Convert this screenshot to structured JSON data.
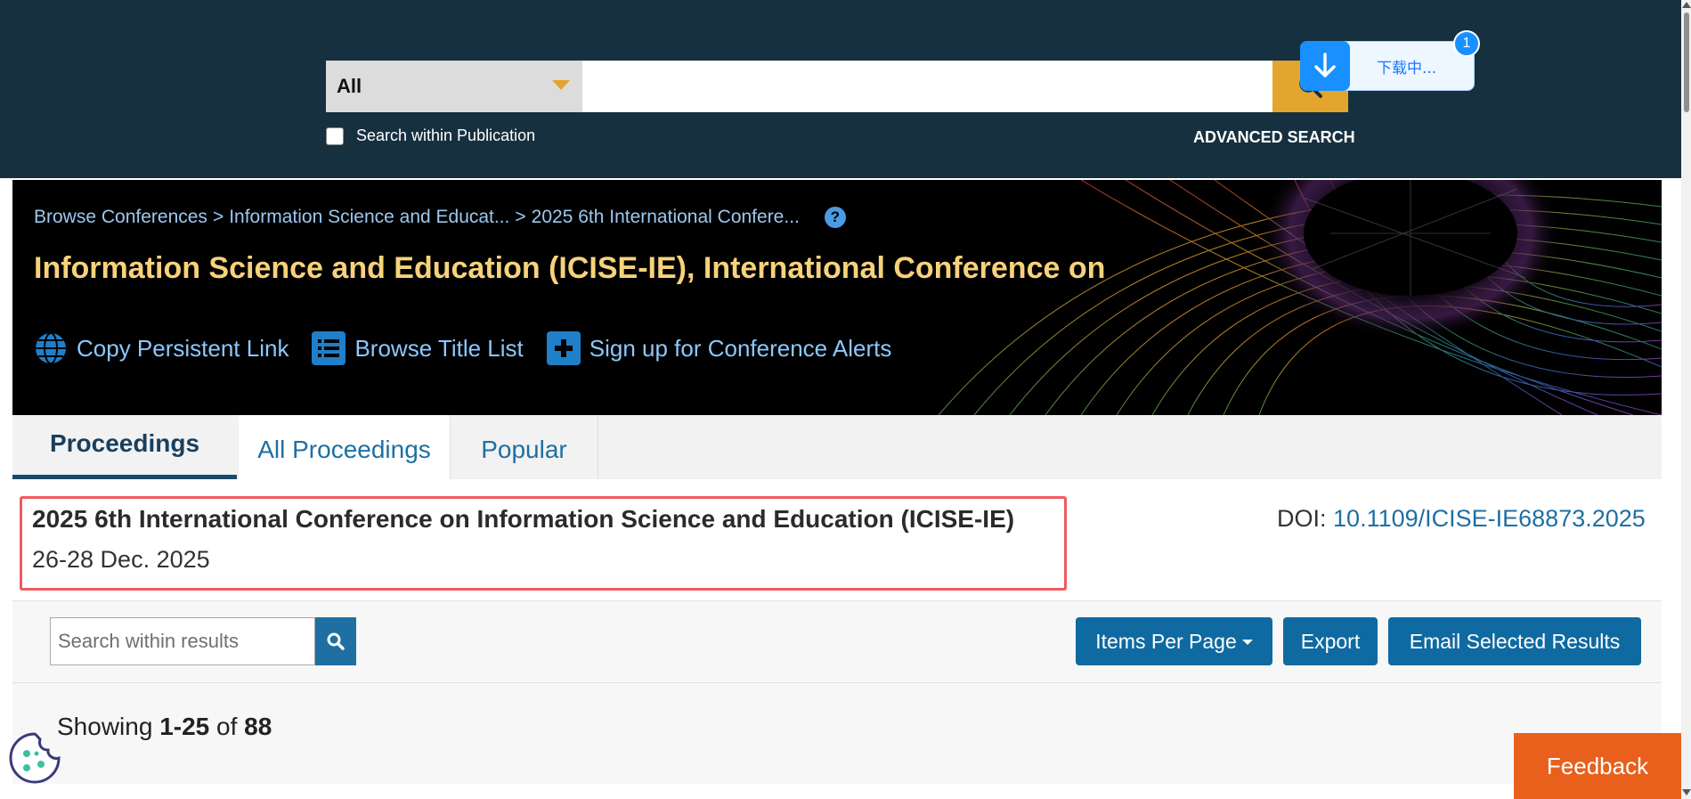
{
  "search": {
    "scope_value": "All",
    "query_value": "",
    "within_label": "Search within Publication",
    "advanced_label": "ADVANCED SEARCH"
  },
  "download": {
    "status": "下载中...",
    "count": "1"
  },
  "banner": {
    "breadcrumb": [
      "Browse Conferences",
      "Information Science and Educat...",
      "2025 6th International Confere..."
    ],
    "breadcrumb_sep": ">",
    "help": "?",
    "title": "Information Science and Education (ICISE-IE), International Conference on",
    "actions": {
      "copy_link": "Copy Persistent Link",
      "browse_titles": "Browse Title List",
      "alerts": "Sign up for Conference Alerts"
    }
  },
  "tabs": {
    "proceedings": "Proceedings",
    "all_proceedings": "All Proceedings",
    "popular": "Popular"
  },
  "proceeding": {
    "title": "2025 6th International Conference on Information Science and Education (ICISE-IE)",
    "date": "26-28 Dec. 2025",
    "doi_label": "DOI:",
    "doi": "10.1109/ICISE-IE68873.2025"
  },
  "results": {
    "search_placeholder": "Search within results",
    "items_per_page": "Items Per Page",
    "export": "Export",
    "email": "Email Selected Results",
    "showing_prefix": "Showing",
    "range": "1-25",
    "of": "of",
    "total": "88"
  },
  "feedback": "Feedback",
  "colors": {
    "topbar": "#16303f",
    "accent_gold": "#e3a52d",
    "link_blue": "#1f6fa3",
    "button_blue": "#0f6aa1",
    "highlight_red": "#ef5a5f",
    "feedback_orange": "#e8601c",
    "banner_title": "#f7d27a"
  }
}
